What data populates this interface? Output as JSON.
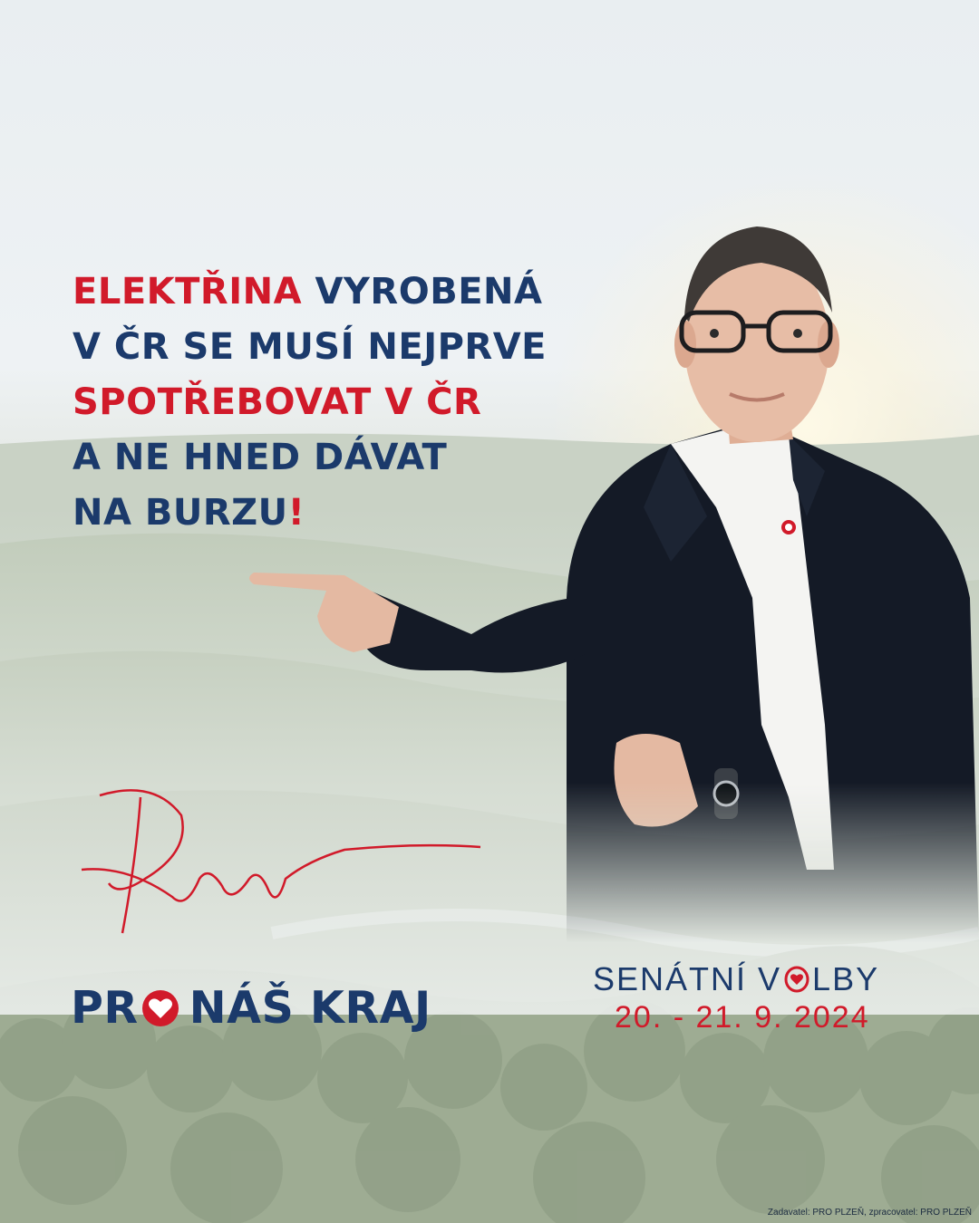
{
  "headline": {
    "line1": {
      "red": "ELEKTŘINA",
      "rest": " VYROBENÁ"
    },
    "line2": {
      "text": "V ČR SE MUSÍ NEJPRVE"
    },
    "line3": {
      "text": "SPOTŘEBOVAT V ČR"
    },
    "line4": {
      "text": "A NE HNED DÁVAT"
    },
    "line5": {
      "text": "NA BURZU",
      "mark": "!"
    }
  },
  "signature": {
    "text": "Kre"
  },
  "brand": {
    "part1": "PR",
    "part2": "NÁŠ KRAJ",
    "icon": "heart-in-o-icon"
  },
  "election": {
    "title_part1": "SENÁTNÍ V",
    "title_part2": "LBY",
    "date": "20. - 21. 9. 2024",
    "icon": "heart-o-icon"
  },
  "footer": {
    "text": "Zadavatel: PRO PLZEŇ, zpracovatel: PRO PLZEŇ"
  },
  "colors": {
    "navy": "#1b3a6b",
    "red": "#d11a2a"
  }
}
